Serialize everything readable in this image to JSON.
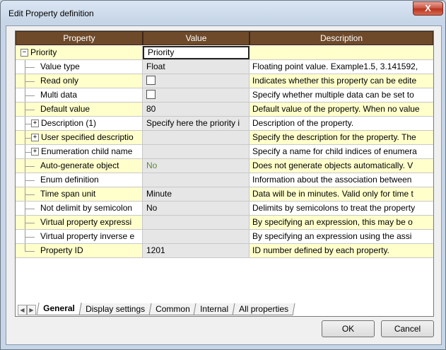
{
  "window": {
    "title": "Edit Property definition",
    "close_symbol": "X"
  },
  "grid": {
    "columns": [
      "Property",
      "Value",
      "Description"
    ],
    "rows": [
      {
        "property": "Priority",
        "value": "Priority",
        "description": "",
        "kind": "group"
      },
      {
        "property": "Value type",
        "value": "Float",
        "description": "Floating point value. Example1.5, 3.141592,",
        "kind": "child",
        "bg": "white"
      },
      {
        "property": "Read only",
        "value": "",
        "description": "Indicates whether this property can be edite",
        "kind": "child",
        "bg": "yellow",
        "checkbox": true
      },
      {
        "property": "Multi data",
        "value": "",
        "description": "Specify whether multiple data can be set to",
        "kind": "child",
        "bg": "white",
        "checkbox": true
      },
      {
        "property": "Default value",
        "value": "80",
        "description": "Default value of the property. When no value",
        "kind": "child",
        "bg": "yellow"
      },
      {
        "property": "Description (1)",
        "value": "Specify here the priority i",
        "description": "Description of the property.",
        "kind": "expandable",
        "bg": "white"
      },
      {
        "property": "User specified descriptio",
        "value": "",
        "description": "Specify the description for the property. The",
        "kind": "expandable",
        "bg": "yellow"
      },
      {
        "property": "Enumeration child name",
        "value": "",
        "description": "Specify a name for child indices of enumera",
        "kind": "expandable",
        "bg": "white"
      },
      {
        "property": "Auto-generate object",
        "value": "No",
        "description": "Does not generate objects automatically. V",
        "kind": "child",
        "bg": "yellow",
        "value_green": true
      },
      {
        "property": "Enum definition",
        "value": "",
        "description": "Information about the association between",
        "kind": "child",
        "bg": "white"
      },
      {
        "property": "Time span unit",
        "value": "Minute",
        "description": "Data will be in minutes. Valid only for time t",
        "kind": "child",
        "bg": "yellow"
      },
      {
        "property": "Not delimit by semicolon",
        "value": "No",
        "description": "Delimits by semicolons to treat the property",
        "kind": "child",
        "bg": "white"
      },
      {
        "property": "Virtual property expressi",
        "value": "",
        "description": "By specifying an expression, this may be o",
        "kind": "child",
        "bg": "yellow"
      },
      {
        "property": "Virtual property inverse e",
        "value": "",
        "description": "By specifying an expression using the assi",
        "kind": "child",
        "bg": "white"
      },
      {
        "property": "Property ID",
        "value": "1201",
        "description": "ID number defined by each property.",
        "kind": "last",
        "bg": "yellow"
      }
    ]
  },
  "tabs": [
    "General",
    "Display settings",
    "Common",
    "Internal",
    "All properties"
  ],
  "active_tab": "General",
  "buttons": {
    "ok": "OK",
    "cancel": "Cancel"
  },
  "colors": {
    "header_bg": "#6e4a2a",
    "row_yellow": "#ffffcc",
    "value_bg": "#e6e6e6"
  },
  "icons": {
    "expander_minus": "⊟",
    "expander_plus": "⊞",
    "arrow_left": "◀",
    "arrow_right": "▶"
  }
}
